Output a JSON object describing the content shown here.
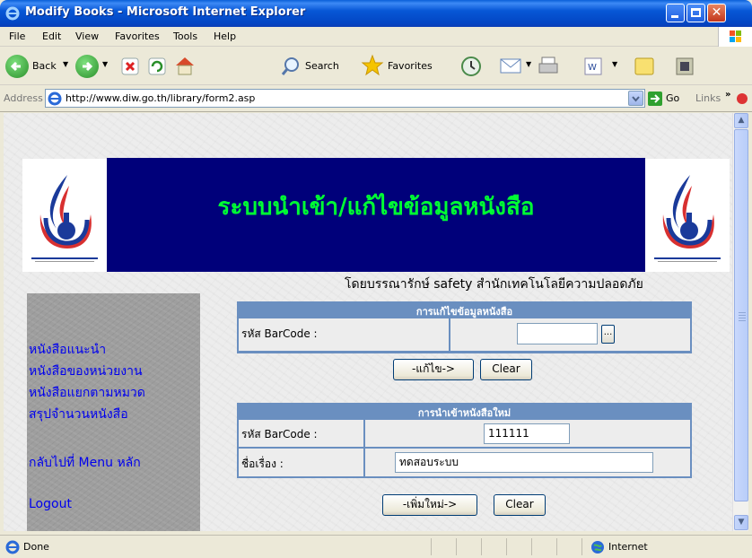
{
  "window": {
    "title": "Modify Books - Microsoft Internet Explorer"
  },
  "menu": [
    "File",
    "Edit",
    "View",
    "Favorites",
    "Tools",
    "Help"
  ],
  "toolbar": {
    "back": "Back",
    "search": "Search",
    "favorites": "Favorites"
  },
  "address": {
    "label": "Address",
    "url": "http://www.diw.go.th/library/form2.asp",
    "go": "Go",
    "links": "Links"
  },
  "banner": {
    "title": "ระบบนำเข้า/แก้ไขข้อมูลหนังสือ"
  },
  "credit": "โดยบรรณารักษ์ safety สำนักเทคโนโลยีความปลอดภัย",
  "sidebar": {
    "links": [
      "หนังสือแนะนำ",
      "หนังสือของหน่วยงาน",
      "หนังสือแยกตามหมวด",
      "สรุปจำนวนหนังสือ"
    ],
    "back_to_menu": "กลับไปที่ Menu หลัก",
    "logout": "Logout"
  },
  "edit_form": {
    "title": "การแก้ไขข้อมูลหนังสือ",
    "barcode_label": "รหัส BarCode :",
    "barcode_value": "",
    "browse_label": "...",
    "submit_label": "-แก้ไข->",
    "clear_label": "Clear"
  },
  "add_form": {
    "title": "การนำเข้าหนังสือใหม่",
    "barcode_label": "รหัส BarCode :",
    "barcode_value": "111111",
    "subject_label": "ชื่อเรื่อง :",
    "subject_value": "ทดสอบระบบ",
    "submit_label": "-เพิ่มใหม่->",
    "clear_label": "Clear"
  },
  "status": {
    "text": "Done",
    "zone": "Internet"
  }
}
